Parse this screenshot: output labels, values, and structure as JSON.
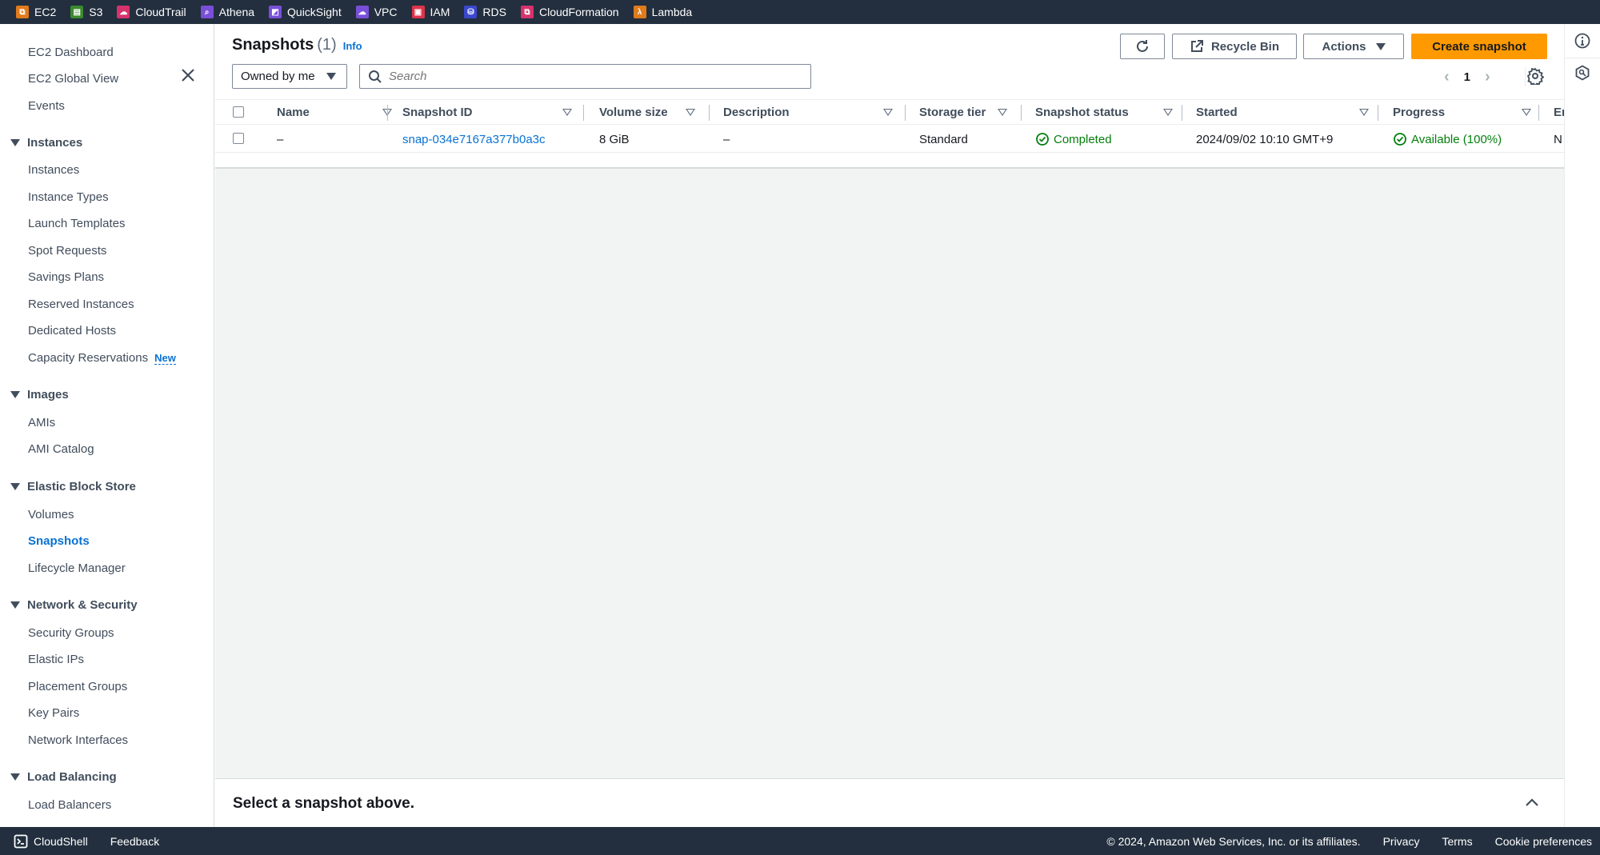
{
  "topbar": {
    "services": [
      {
        "label": "EC2",
        "icon": "ec2-icon",
        "color": "#e07b1c"
      },
      {
        "label": "S3",
        "icon": "s3-icon",
        "color": "#3b8a2e"
      },
      {
        "label": "CloudTrail",
        "icon": "cloudtrail-icon",
        "color": "#d6336c"
      },
      {
        "label": "Athena",
        "icon": "athena-icon",
        "color": "#7a4fd8"
      },
      {
        "label": "QuickSight",
        "icon": "quicksight-icon",
        "color": "#7a4fd8"
      },
      {
        "label": "VPC",
        "icon": "vpc-icon",
        "color": "#7a4fd8"
      },
      {
        "label": "IAM",
        "icon": "iam-icon",
        "color": "#dd344c"
      },
      {
        "label": "RDS",
        "icon": "rds-icon",
        "color": "#3b48cc"
      },
      {
        "label": "CloudFormation",
        "icon": "cloudformation-icon",
        "color": "#d6336c"
      },
      {
        "label": "Lambda",
        "icon": "lambda-icon",
        "color": "#e07b1c"
      }
    ]
  },
  "sidebar": {
    "top_items": [
      "EC2 Dashboard",
      "EC2 Global View",
      "Events"
    ],
    "sections": [
      {
        "title": "Instances",
        "items": [
          "Instances",
          "Instance Types",
          "Launch Templates",
          "Spot Requests",
          "Savings Plans",
          "Reserved Instances",
          "Dedicated Hosts",
          "Capacity Reservations"
        ]
      },
      {
        "title": "Images",
        "items": [
          "AMIs",
          "AMI Catalog"
        ]
      },
      {
        "title": "Elastic Block Store",
        "items": [
          "Volumes",
          "Snapshots",
          "Lifecycle Manager"
        ]
      },
      {
        "title": "Network & Security",
        "items": [
          "Security Groups",
          "Elastic IPs",
          "Placement Groups",
          "Key Pairs",
          "Network Interfaces"
        ]
      },
      {
        "title": "Load Balancing",
        "items": [
          "Load Balancers"
        ]
      }
    ],
    "new_badge": "New",
    "active_item": "Snapshots"
  },
  "header": {
    "title": "Snapshots",
    "count": "(1)",
    "info_link": "Info",
    "recycle_bin": "Recycle Bin",
    "actions": "Actions",
    "create": "Create snapshot"
  },
  "filter": {
    "owner_selected": "Owned by me",
    "search_placeholder": "Search"
  },
  "pagination": {
    "current_page": "1"
  },
  "table": {
    "columns": [
      "Name",
      "Snapshot ID",
      "Volume size",
      "Description",
      "Storage tier",
      "Snapshot status",
      "Started",
      "Progress",
      "En"
    ],
    "rows": [
      {
        "name": "–",
        "snapshot_id": "snap-034e7167a377b0a3c",
        "volume_size": "8 GiB",
        "description": "–",
        "storage_tier": "Standard",
        "status": "Completed",
        "started": "2024/09/02 10:10 GMT+9",
        "progress": "Available (100%)",
        "encryption": "N"
      }
    ]
  },
  "split_panel": {
    "title": "Select a snapshot above."
  },
  "footer": {
    "cloudshell": "CloudShell",
    "feedback": "Feedback",
    "copyright": "© 2024, Amazon Web Services, Inc. or its affiliates.",
    "privacy": "Privacy",
    "terms": "Terms",
    "cookies": "Cookie preferences"
  }
}
